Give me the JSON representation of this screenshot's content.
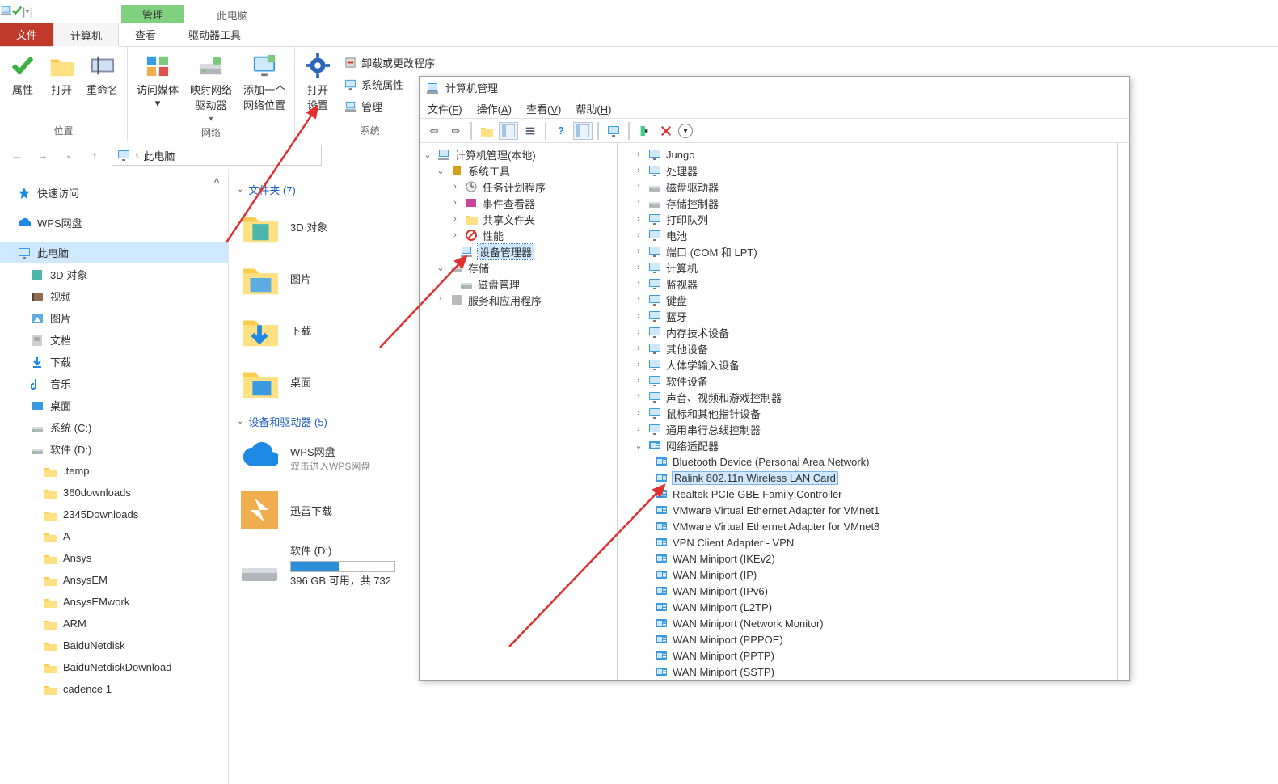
{
  "titlebar": {
    "context_tab": "管理",
    "app_title": "此电脑"
  },
  "ribbon": {
    "tabs": {
      "file": "文件",
      "computer": "计算机",
      "view": "查看",
      "drive_tools": "驱动器工具"
    },
    "position_group": "位置",
    "network_group": "网络",
    "system_group": "系统",
    "btn_properties": "属性",
    "btn_open": "打开",
    "btn_rename": "重命名",
    "btn_access_media": "访问媒体",
    "btn_map_drive": "映射网络\n驱动器",
    "btn_add_net_loc": "添加一个\n网络位置",
    "btn_open_settings": "打开\n设置",
    "link_uninstall": "卸载或更改程序",
    "link_sys_props": "系统属性",
    "link_manage": "管理"
  },
  "breadcrumb": {
    "this_pc": "此电脑"
  },
  "sidebar": {
    "quick": "快速访问",
    "wps": "WPS网盘",
    "thispc": "此电脑",
    "items": [
      "3D 对象",
      "视频",
      "图片",
      "文档",
      "下载",
      "音乐",
      "桌面",
      "系统 (C:)",
      "软件 (D:)"
    ],
    "dfolders": [
      ".temp",
      "360downloads",
      "2345Downloads",
      "A",
      "Ansys",
      "AnsysEM",
      "AnsysEMwork",
      "ARM",
      "BaiduNetdisk",
      "BaiduNetdiskDownload",
      "cadence 1"
    ]
  },
  "main": {
    "folders_hdr": "文件夹 (7)",
    "devices_hdr": "设备和驱动器 (5)",
    "tile_3d": "3D 对象",
    "tile_pic": "图片",
    "tile_dl": "下载",
    "tile_desktop": "桌面",
    "wps_tile": "WPS网盘",
    "wps_tile_sub": "双击进入WPS网盘",
    "xunlei": "迅雷下载",
    "drive_d": "软件 (D:)",
    "drive_d_stat": "396 GB 可用，共 732"
  },
  "cm": {
    "title": "计算机管理",
    "menu": {
      "file": "文件(F)",
      "action": "操作(A)",
      "view": "查看(V)",
      "help": "帮助(H)"
    },
    "left": {
      "root": "计算机管理(本地)",
      "systools": "系统工具",
      "task": "任务计划程序",
      "event": "事件查看器",
      "shared": "共享文件夹",
      "perf": "性能",
      "devmgr": "设备管理器",
      "storage": "存储",
      "diskmgr": "磁盘管理",
      "svcapps": "服务和应用程序"
    },
    "right": {
      "jungo": "Jungo",
      "cpu": "处理器",
      "diskdrv": "磁盘驱动器",
      "storectrl": "存储控制器",
      "printq": "打印队列",
      "battery": "电池",
      "ports": "端口 (COM 和 LPT)",
      "computer": "计算机",
      "monitor": "监视器",
      "keyboard": "键盘",
      "bluetooth": "蓝牙",
      "memory": "内存技术设备",
      "other": "其他设备",
      "hid": "人体学输入设备",
      "software": "软件设备",
      "audio": "声音、视频和游戏控制器",
      "mouse": "鼠标和其他指针设备",
      "usb": "通用串行总线控制器",
      "netadapter": "网络适配器",
      "net_items": [
        "Bluetooth Device (Personal Area Network)",
        "Ralink 802.11n Wireless LAN Card",
        "Realtek PCIe GBE Family Controller",
        "VMware Virtual Ethernet Adapter for VMnet1",
        "VMware Virtual Ethernet Adapter for VMnet8",
        "VPN Client Adapter - VPN",
        "WAN Miniport (IKEv2)",
        "WAN Miniport (IP)",
        "WAN Miniport (IPv6)",
        "WAN Miniport (L2TP)",
        "WAN Miniport (Network Monitor)",
        "WAN Miniport (PPPOE)",
        "WAN Miniport (PPTP)",
        "WAN Miniport (SSTP)"
      ]
    }
  }
}
